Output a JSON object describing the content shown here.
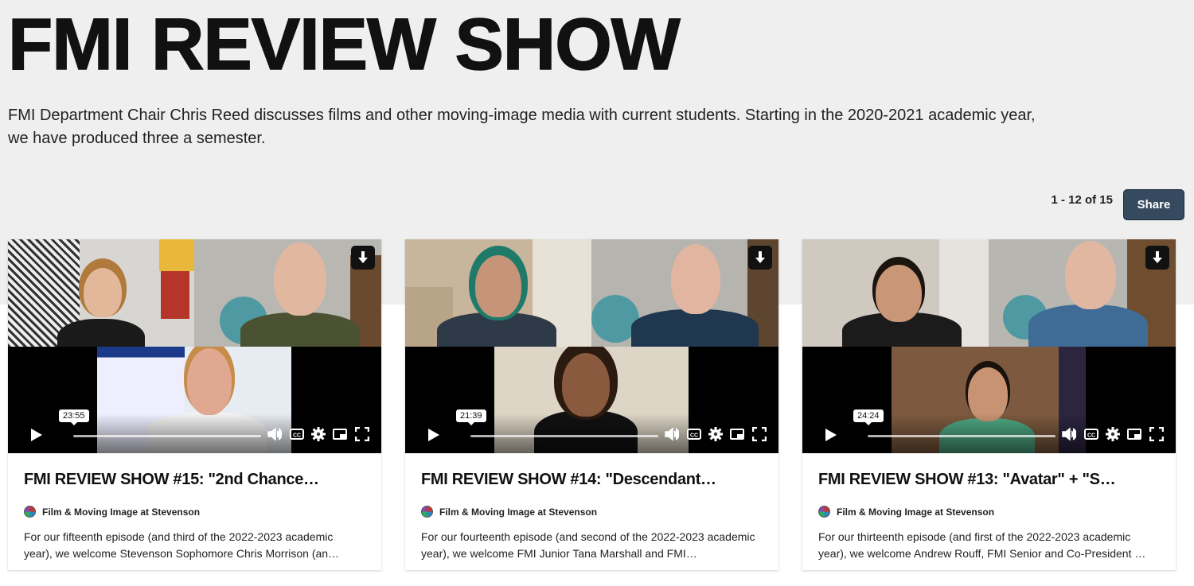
{
  "page": {
    "title": "FMI REVIEW SHOW",
    "description": "FMI Department Chair Chris Reed discusses films and other moving-image media with current students. Starting in the 2020-2021 academic year, we have produced three a semester.",
    "pager": "1 - 12 of 15",
    "share_label": "Share"
  },
  "videos": [
    {
      "title": "FMI REVIEW SHOW #15: \"2nd Chance…",
      "duration": "23:55",
      "channel": "Film & Moving Image at Stevenson",
      "description": "For our fifteenth episode (and third of the 2022-2023 academic year), we welcome Stevenson Sophomore Chris Morrison (an…"
    },
    {
      "title": "FMI REVIEW SHOW #14: \"Descendant…",
      "duration": "21:39",
      "channel": "Film & Moving Image at Stevenson",
      "description": "For our fourteenth episode (and second of the 2022-2023 academic year), we welcome FMI Junior Tana Marshall and FMI…"
    },
    {
      "title": "FMI REVIEW SHOW #13: \"Avatar\" + \"S…",
      "duration": "24:24",
      "channel": "Film & Moving Image at Stevenson",
      "description": "For our thirteenth episode (and first of the 2022-2023 academic year), we welcome Andrew Rouff, FMI Senior and Co-President …"
    }
  ],
  "icons": {
    "download": "download-icon",
    "play": "play-icon",
    "volume": "volume-icon",
    "captions": "captions-icon",
    "settings": "gear-icon",
    "pip": "picture-in-picture-icon",
    "fullscreen": "fullscreen-icon"
  },
  "colors": {
    "share_button": "#354a5e",
    "header_bg": "#efefef"
  }
}
